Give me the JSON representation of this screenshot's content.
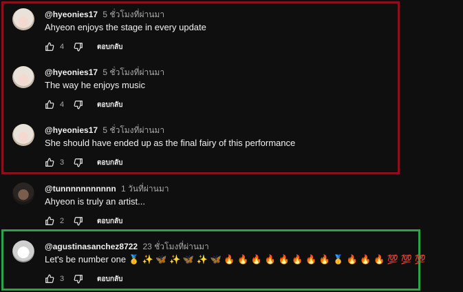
{
  "comments": [
    {
      "author": "@hyeonies17",
      "time": "5 ชั่วโมงที่ผ่านมา",
      "text": "Ahyeon enjoys the stage in every update",
      "likes": "4",
      "reply": "ตอบกลับ"
    },
    {
      "author": "@hyeonies17",
      "time": "5 ชั่วโมงที่ผ่านมา",
      "text": "The way he enjoys music",
      "likes": "4",
      "reply": "ตอบกลับ"
    },
    {
      "author": "@hyeonies17",
      "time": "5 ชั่วโมงที่ผ่านมา",
      "text": "She should have ended up as the final fairy of this performance",
      "likes": "3",
      "reply": "ตอบกลับ"
    },
    {
      "author": "@tunnnnnnnnnnn",
      "time": "1 วันที่ผ่านมา",
      "text": "Ahyeon is truly an artist...",
      "likes": "2",
      "reply": "ตอบกลับ"
    },
    {
      "author": "@agustinasanchez8722",
      "time": "23 ชั่วโมงที่ผ่านมา",
      "text": "Let's be number one 🥇 ✨ 🦋 ✨ 🦋 ✨ 🦋  🔥 🔥 🔥 🔥 🔥 🔥 🔥 🔥 🥇 🔥 🔥 🔥 💯 💯 💯",
      "likes": "3",
      "reply": "ตอบกลับ"
    }
  ],
  "highlight_colors": {
    "red": "#8b0f1e",
    "green": "#2aa54a"
  }
}
